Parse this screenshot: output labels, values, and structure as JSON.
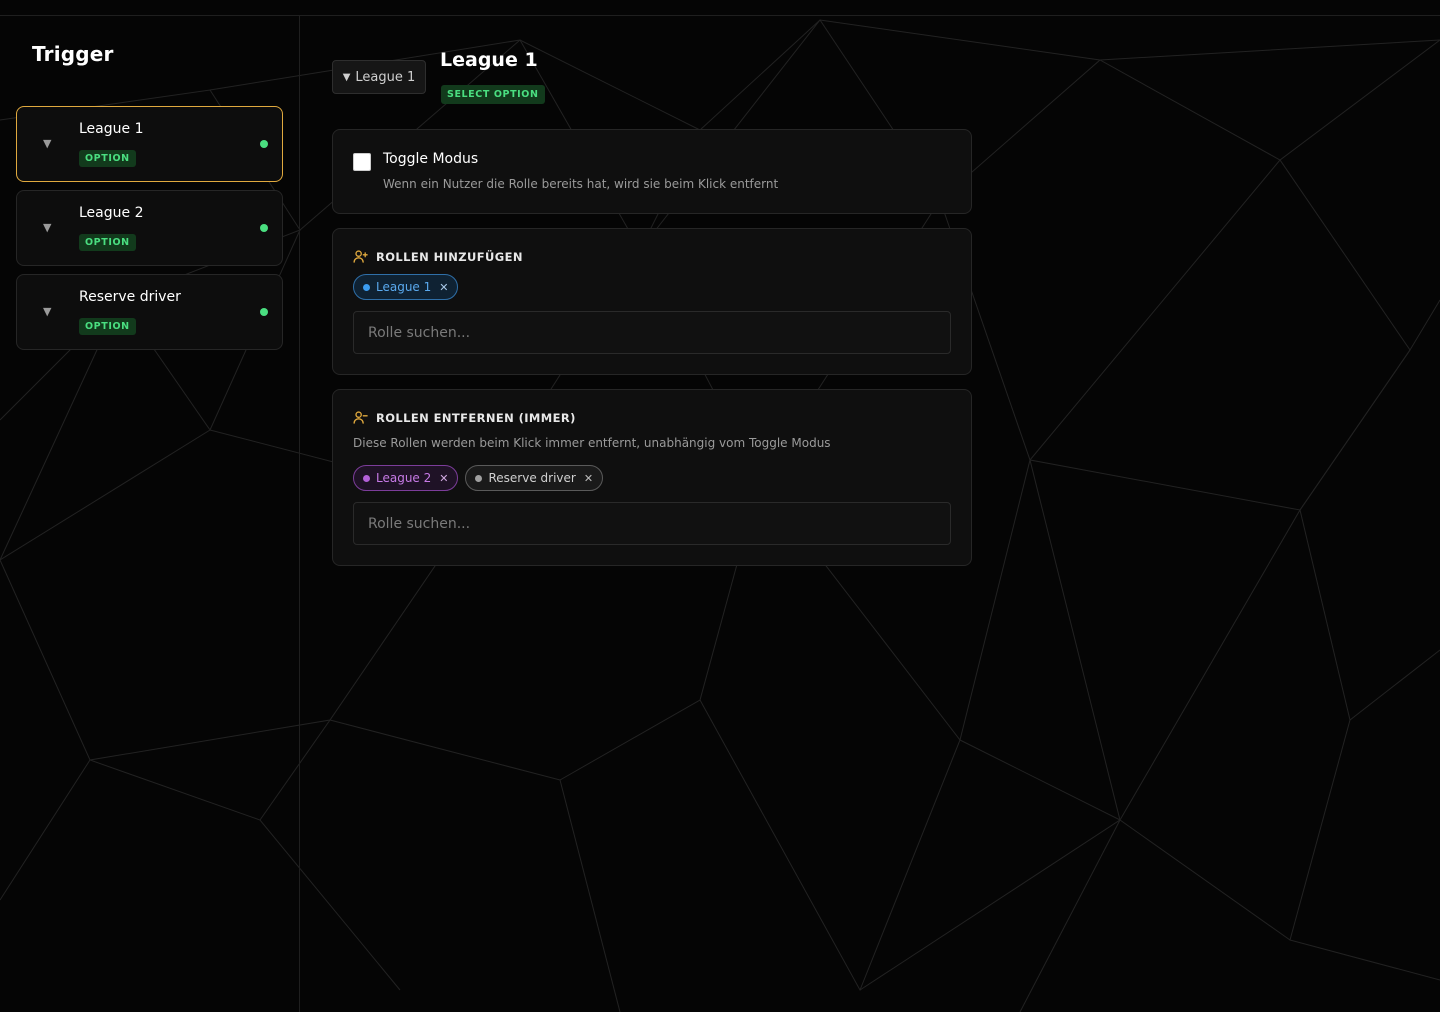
{
  "sidebar": {
    "title": "Trigger",
    "items": [
      {
        "label": "League 1",
        "badge": "OPTION"
      },
      {
        "label": "League 2",
        "badge": "OPTION"
      },
      {
        "label": "Reserve driver",
        "badge": "OPTION"
      }
    ]
  },
  "main": {
    "crumb_label": "League 1",
    "title": "League 1",
    "badge": "SELECT OPTION",
    "toggle": {
      "label": "Toggle Modus",
      "description": "Wenn ein Nutzer die Rolle bereits hat, wird sie beim Klick entfernt"
    },
    "add_roles": {
      "heading": "ROLLEN HINZUFÜGEN",
      "chips": [
        {
          "label": "League 1"
        }
      ],
      "search_placeholder": "Rolle suchen..."
    },
    "remove_roles": {
      "heading": "ROLLEN ENTFERNEN (IMMER)",
      "description": "Diese Rollen werden beim Klick immer entfernt, unabhängig vom Toggle Modus",
      "chips": [
        {
          "label": "League 2"
        },
        {
          "label": "Reserve driver"
        }
      ],
      "search_placeholder": "Rolle suchen..."
    }
  },
  "colors": {
    "accent_active_border": "#e0a93e",
    "option_green": "#4ade80",
    "chip_blue": "#3b9cf0",
    "chip_purple": "#b360d8",
    "chip_gray": "#a0a0a0"
  },
  "icons": {
    "trigger_arrow": "triangle-down-icon",
    "add_roles": "user-plus-icon",
    "remove_roles": "user-minus-icon",
    "chip_remove": "close-icon"
  }
}
